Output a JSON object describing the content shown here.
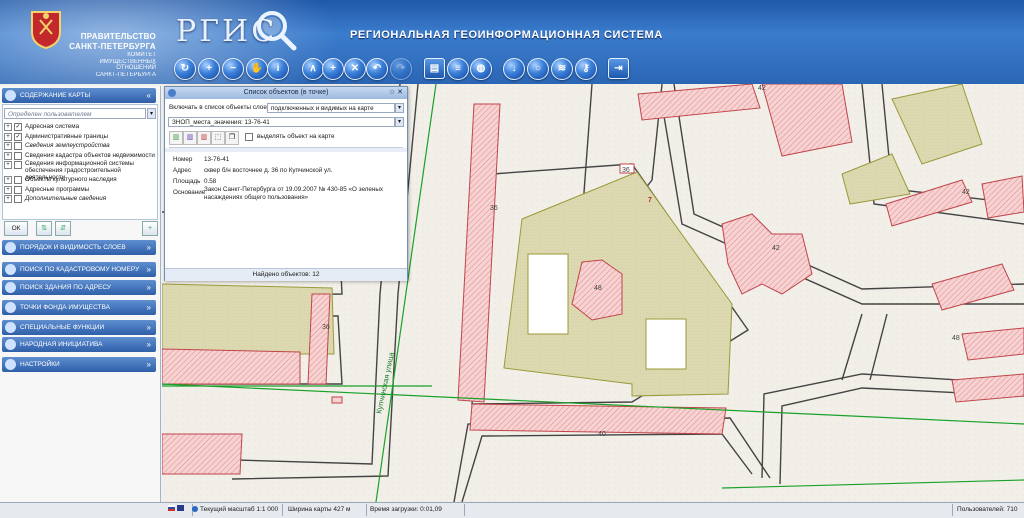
{
  "header": {
    "gov_line1": "ПРАВИТЕЛЬСТВО",
    "gov_line2": "САНКТ-ПЕТЕРБУРГА",
    "committee": [
      "КОМИТЕТ",
      "ИМУЩЕСТВЕННЫХ",
      "ОТНОШЕНИЙ",
      "САНКТ-ПЕТЕРБУРГА"
    ],
    "logo": "РГИС",
    "system_title": "РЕГИОНАЛЬНАЯ  ГЕОИНФОРМАЦИОННАЯ СИСТЕМА"
  },
  "toolbar_icons": [
    "home-icon",
    "zoom-in-icon",
    "zoom-out-icon",
    "pan-hand-icon",
    "info-icon",
    "measure-icon",
    "add-icon",
    "clear-icon",
    "back-icon",
    "forward-icon",
    "print-icon",
    "list-icon",
    "globe-icon",
    "download-icon",
    "search-icon",
    "rss-icon",
    "key-icon",
    "exit-icon"
  ],
  "left_panel": {
    "sections": [
      {
        "id": "content",
        "label": "СОДЕРЖАНИЕ КАРТЫ",
        "chevron": "«"
      },
      {
        "id": "order",
        "label": "ПОРЯДОК И ВИДИМОСТЬ СЛОЕВ",
        "chevron": "»"
      },
      {
        "id": "cadastral",
        "label": "ПОИСК ПО КАДАСТРОВОМУ НОМЕРУ",
        "chevron": "»"
      },
      {
        "id": "address",
        "label": "ПОИСК ЗДАНИЯ ПО АДРЕСУ",
        "chevron": "»"
      },
      {
        "id": "fund",
        "label": "ТОЧКИ ФОНДА ИМУЩЕСТВА",
        "chevron": "»"
      },
      {
        "id": "special",
        "label": "СПЕЦИАЛЬНЫЕ ФУНКЦИИ",
        "chevron": "»"
      },
      {
        "id": "initiative",
        "label": "НАРОДНАЯ ИНИЦИАТИВА",
        "chevron": "»"
      },
      {
        "id": "settings",
        "label": "НАСТРОЙКИ",
        "chevron": "»"
      }
    ],
    "user_select_placeholder": "Определен пользователем",
    "tree": [
      {
        "label": "Адресная система",
        "checked": true,
        "italic": false
      },
      {
        "label": "Административные границы",
        "checked": true,
        "italic": false
      },
      {
        "label": "Сведения землеустройства",
        "checked": false,
        "italic": true
      },
      {
        "label": "Сведения кадастра объектов недвижимости",
        "checked": false,
        "italic": false
      },
      {
        "label": "Сведения информационной системы обеспечения градостроительной деятельности",
        "checked": false,
        "italic": false
      },
      {
        "label": "Объекты культурного наследия",
        "checked": false,
        "italic": false
      },
      {
        "label": "Адресные программы",
        "checked": false,
        "italic": false
      },
      {
        "label": "Дополнительные сведения",
        "checked": false,
        "italic": true
      }
    ],
    "ok_label": "ОК"
  },
  "popup": {
    "title": "Список объектов (в точке)",
    "include_label": "Включать в список объекты слоев:",
    "include_value": "подключенных и видимых на карте",
    "layer_value": "ЗНОП_места_значения: 13-76-41",
    "highlight_label": "выделять объект на карте",
    "fields": [
      {
        "key": "Номер",
        "value": "13-76-41"
      },
      {
        "key": "Адрес",
        "value": "сквер б/н восточнее д. 36 по Купчинской ул."
      },
      {
        "key": "Площадь",
        "value": "0.58"
      },
      {
        "key": "Основание",
        "value": "Закон Санкт-Петербурга от 19.09.2007 № 430-85 «О зеленых насаждениях общего пользования»"
      }
    ],
    "found": "Найдено объектов: 12"
  },
  "map": {
    "street_label": "Купчинская улица",
    "labels": [
      "36",
      "36",
      "40",
      "42",
      "42",
      "42",
      "48",
      "48",
      "7",
      "36"
    ]
  },
  "status": {
    "scale": "Текущий масштаб 1:1 000",
    "width": "Ширина карты 427 м",
    "load": "Время загрузки: 0:01,09",
    "users": "Пользователей: 710"
  },
  "colors": {
    "header_blue": "#2b66b5",
    "building_fill": "#f6c9c9",
    "building_stroke": "#c0454a",
    "green_zone": "#dcd9b0",
    "green_stroke": "#9a9a3a",
    "boundary_green": "#1aa12a"
  }
}
